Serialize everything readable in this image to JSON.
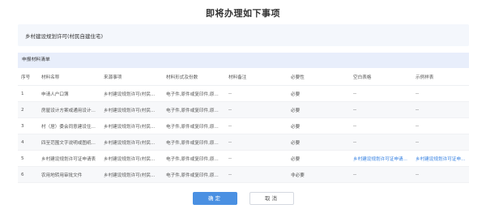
{
  "dialog": {
    "title": "即将办理如下事项",
    "matter": "乡村建设规划许可(村民自建住宅)"
  },
  "materials": {
    "caption": "申报材料清单",
    "columns": [
      "序号",
      "材料名称",
      "来源事项",
      "材料形式及份数",
      "材料备注",
      "必要性",
      "空白表格",
      "示例样表"
    ],
    "rows": [
      [
        "1",
        "申请人户口簿",
        "乡村建设规划许可(村民...",
        "电子件,原件或复印件,原...",
        "--",
        "必要",
        "--",
        "--"
      ],
      [
        "2",
        "房屋设计方案或通用设计...",
        "乡村建设规划许可(村民...",
        "电子件,原件或复印件,原...",
        "--",
        "必要",
        "--",
        "--"
      ],
      [
        "3",
        "村（居）委会同意建设住...",
        "乡村建设规划许可(村民...",
        "电子件,原件或复印件,原...",
        "--",
        "必要",
        "--",
        "--"
      ],
      [
        "4",
        "四至范围文字说明或图纸...",
        "乡村建设规划许可(村民...",
        "电子件,原件或复印件,原...",
        "--",
        "必要",
        "--",
        "--"
      ],
      [
        "5",
        "乡村建设规划许可证申请表",
        "乡村建设规划许可(村民...",
        "电子件,原件或复印件,原...",
        "--",
        "必要",
        "乡村建设规划许可证申请...",
        "乡村建设规划许可证申请..."
      ],
      [
        "6",
        "农用地转用审批文件",
        "乡村建设规划许可(村民...",
        "电子件,原件或复印件,原...",
        "--",
        "非必要",
        "--",
        "--"
      ]
    ]
  },
  "buttons": {
    "confirm": "确定",
    "cancel": "取消"
  },
  "colors": {
    "primary": "#4a90e2",
    "link": "#2f7de1",
    "caption_bg": "#e8eefb"
  }
}
